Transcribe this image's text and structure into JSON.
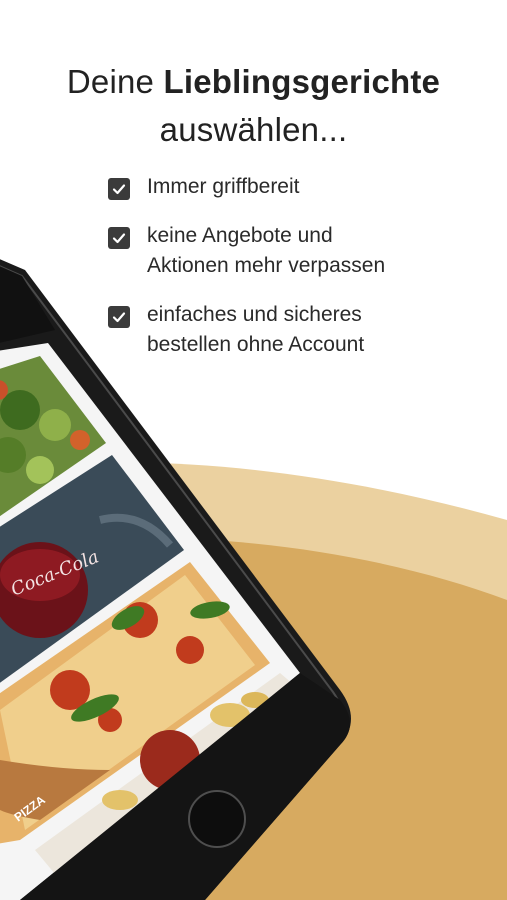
{
  "header": {
    "title_prefix": "Deine",
    "title_bold": "Lieblingsgerichte",
    "title_line2": "auswählen..."
  },
  "features": [
    {
      "lines": [
        "Immer griffbereit"
      ]
    },
    {
      "lines": [
        "keine Angebote und",
        "Aktionen mehr verpassen"
      ]
    },
    {
      "lines": [
        "einfaches und sicheres",
        "bestellen ohne Account"
      ]
    }
  ],
  "phone": {
    "cards": [
      {
        "name": "salad",
        "label": ""
      },
      {
        "name": "cola",
        "label": ""
      },
      {
        "name": "pizza",
        "label": "PIZZA"
      },
      {
        "name": "pasta",
        "label": ""
      }
    ]
  },
  "colors": {
    "accent": "#d8ad63",
    "accent_light": "#e9cd9a",
    "check": "#3b3b3b"
  }
}
